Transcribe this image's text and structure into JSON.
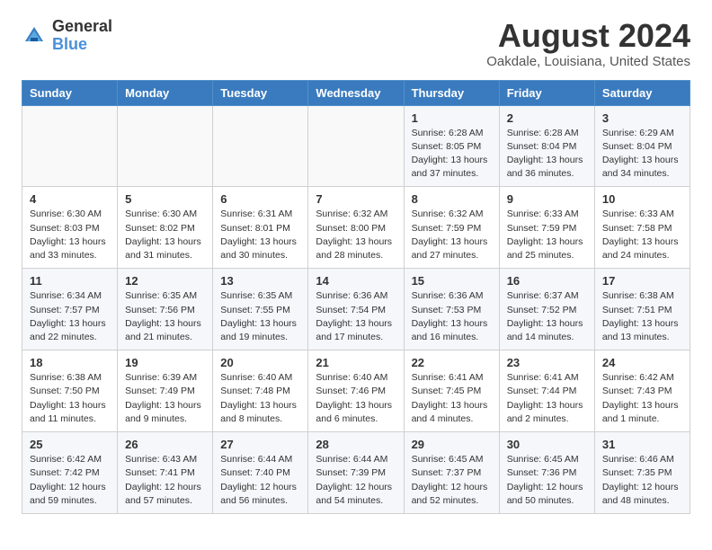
{
  "logo": {
    "general": "General",
    "blue": "Blue"
  },
  "title": "August 2024",
  "subtitle": "Oakdale, Louisiana, United States",
  "weekdays": [
    "Sunday",
    "Monday",
    "Tuesday",
    "Wednesday",
    "Thursday",
    "Friday",
    "Saturday"
  ],
  "weeks": [
    [
      {
        "day": "",
        "info": ""
      },
      {
        "day": "",
        "info": ""
      },
      {
        "day": "",
        "info": ""
      },
      {
        "day": "",
        "info": ""
      },
      {
        "day": "1",
        "info": "Sunrise: 6:28 AM\nSunset: 8:05 PM\nDaylight: 13 hours\nand 37 minutes."
      },
      {
        "day": "2",
        "info": "Sunrise: 6:28 AM\nSunset: 8:04 PM\nDaylight: 13 hours\nand 36 minutes."
      },
      {
        "day": "3",
        "info": "Sunrise: 6:29 AM\nSunset: 8:04 PM\nDaylight: 13 hours\nand 34 minutes."
      }
    ],
    [
      {
        "day": "4",
        "info": "Sunrise: 6:30 AM\nSunset: 8:03 PM\nDaylight: 13 hours\nand 33 minutes."
      },
      {
        "day": "5",
        "info": "Sunrise: 6:30 AM\nSunset: 8:02 PM\nDaylight: 13 hours\nand 31 minutes."
      },
      {
        "day": "6",
        "info": "Sunrise: 6:31 AM\nSunset: 8:01 PM\nDaylight: 13 hours\nand 30 minutes."
      },
      {
        "day": "7",
        "info": "Sunrise: 6:32 AM\nSunset: 8:00 PM\nDaylight: 13 hours\nand 28 minutes."
      },
      {
        "day": "8",
        "info": "Sunrise: 6:32 AM\nSunset: 7:59 PM\nDaylight: 13 hours\nand 27 minutes."
      },
      {
        "day": "9",
        "info": "Sunrise: 6:33 AM\nSunset: 7:59 PM\nDaylight: 13 hours\nand 25 minutes."
      },
      {
        "day": "10",
        "info": "Sunrise: 6:33 AM\nSunset: 7:58 PM\nDaylight: 13 hours\nand 24 minutes."
      }
    ],
    [
      {
        "day": "11",
        "info": "Sunrise: 6:34 AM\nSunset: 7:57 PM\nDaylight: 13 hours\nand 22 minutes."
      },
      {
        "day": "12",
        "info": "Sunrise: 6:35 AM\nSunset: 7:56 PM\nDaylight: 13 hours\nand 21 minutes."
      },
      {
        "day": "13",
        "info": "Sunrise: 6:35 AM\nSunset: 7:55 PM\nDaylight: 13 hours\nand 19 minutes."
      },
      {
        "day": "14",
        "info": "Sunrise: 6:36 AM\nSunset: 7:54 PM\nDaylight: 13 hours\nand 17 minutes."
      },
      {
        "day": "15",
        "info": "Sunrise: 6:36 AM\nSunset: 7:53 PM\nDaylight: 13 hours\nand 16 minutes."
      },
      {
        "day": "16",
        "info": "Sunrise: 6:37 AM\nSunset: 7:52 PM\nDaylight: 13 hours\nand 14 minutes."
      },
      {
        "day": "17",
        "info": "Sunrise: 6:38 AM\nSunset: 7:51 PM\nDaylight: 13 hours\nand 13 minutes."
      }
    ],
    [
      {
        "day": "18",
        "info": "Sunrise: 6:38 AM\nSunset: 7:50 PM\nDaylight: 13 hours\nand 11 minutes."
      },
      {
        "day": "19",
        "info": "Sunrise: 6:39 AM\nSunset: 7:49 PM\nDaylight: 13 hours\nand 9 minutes."
      },
      {
        "day": "20",
        "info": "Sunrise: 6:40 AM\nSunset: 7:48 PM\nDaylight: 13 hours\nand 8 minutes."
      },
      {
        "day": "21",
        "info": "Sunrise: 6:40 AM\nSunset: 7:46 PM\nDaylight: 13 hours\nand 6 minutes."
      },
      {
        "day": "22",
        "info": "Sunrise: 6:41 AM\nSunset: 7:45 PM\nDaylight: 13 hours\nand 4 minutes."
      },
      {
        "day": "23",
        "info": "Sunrise: 6:41 AM\nSunset: 7:44 PM\nDaylight: 13 hours\nand 2 minutes."
      },
      {
        "day": "24",
        "info": "Sunrise: 6:42 AM\nSunset: 7:43 PM\nDaylight: 13 hours\nand 1 minute."
      }
    ],
    [
      {
        "day": "25",
        "info": "Sunrise: 6:42 AM\nSunset: 7:42 PM\nDaylight: 12 hours\nand 59 minutes."
      },
      {
        "day": "26",
        "info": "Sunrise: 6:43 AM\nSunset: 7:41 PM\nDaylight: 12 hours\nand 57 minutes."
      },
      {
        "day": "27",
        "info": "Sunrise: 6:44 AM\nSunset: 7:40 PM\nDaylight: 12 hours\nand 56 minutes."
      },
      {
        "day": "28",
        "info": "Sunrise: 6:44 AM\nSunset: 7:39 PM\nDaylight: 12 hours\nand 54 minutes."
      },
      {
        "day": "29",
        "info": "Sunrise: 6:45 AM\nSunset: 7:37 PM\nDaylight: 12 hours\nand 52 minutes."
      },
      {
        "day": "30",
        "info": "Sunrise: 6:45 AM\nSunset: 7:36 PM\nDaylight: 12 hours\nand 50 minutes."
      },
      {
        "day": "31",
        "info": "Sunrise: 6:46 AM\nSunset: 7:35 PM\nDaylight: 12 hours\nand 48 minutes."
      }
    ]
  ]
}
